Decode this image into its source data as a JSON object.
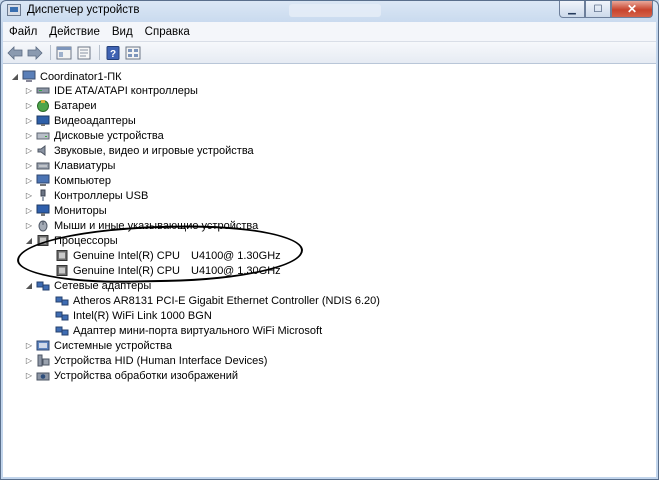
{
  "window": {
    "title": "Диспетчер устройств"
  },
  "menu": [
    {
      "label": "Файл"
    },
    {
      "label": "Действие"
    },
    {
      "label": "Вид"
    },
    {
      "label": "Справка"
    }
  ],
  "tree": {
    "root": "Coordinator1-ПК",
    "categories": [
      "IDE ATA/ATAPI контроллеры",
      "Батареи",
      "Видеоадаптеры",
      "Дисковые устройства",
      "Звуковые, видео и игровые устройства",
      "Клавиатуры",
      "Компьютер",
      "Контроллеры USB",
      "Мониторы",
      "Мыши и иные указывающие устройства",
      "Процессоры",
      "Сетевые адаптеры",
      "Системные устройства",
      "Устройства HID (Human Interface Devices)",
      "Устройства обработки изображений"
    ],
    "processors": [
      {
        "name": "Genuine Intel(R) CPU",
        "model": "U4100",
        "freq": "@ 1.30GHz"
      },
      {
        "name": "Genuine Intel(R) CPU",
        "model": "U4100",
        "freq": "@ 1.30GHz"
      }
    ],
    "network": [
      "Atheros AR8131 PCI-E Gigabit Ethernet Controller (NDIS 6.20)",
      "Intel(R) WiFi Link 1000 BGN",
      "Адаптер мини-порта виртуального WiFi Microsoft"
    ]
  }
}
